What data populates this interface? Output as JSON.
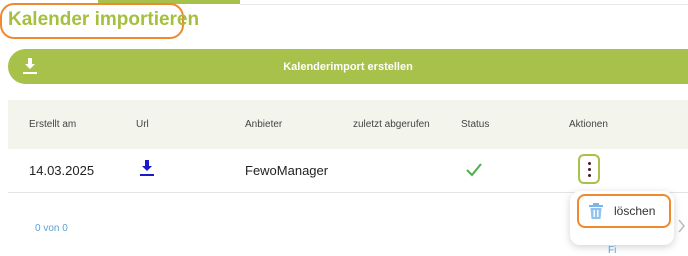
{
  "page": {
    "title": "Kalender importieren"
  },
  "toolbar": {
    "import_label": "Kalenderimport erstellen",
    "import_icon": "download-icon"
  },
  "table": {
    "headers": [
      "Erstellt am",
      "Url",
      "Anbieter",
      "zuletzt abgerufen",
      "Status",
      "Aktionen"
    ],
    "rows": [
      {
        "created": "14.03.2025",
        "url_icon": "download-icon",
        "provider": "FewoManager",
        "last_fetched": "",
        "status_icon": "checkmark-icon",
        "actions_icon": "kebab-menu-icon"
      }
    ]
  },
  "actions_menu": {
    "delete_label": "löschen",
    "delete_icon": "trash-icon"
  },
  "pagination": {
    "text": "0 von 0"
  },
  "bottom_link": {
    "text": "Fi"
  },
  "colors": {
    "accent": "#a8c14a",
    "highlight": "#f0892e",
    "link": "#5aa2d8",
    "status_ok": "#4caf50"
  }
}
